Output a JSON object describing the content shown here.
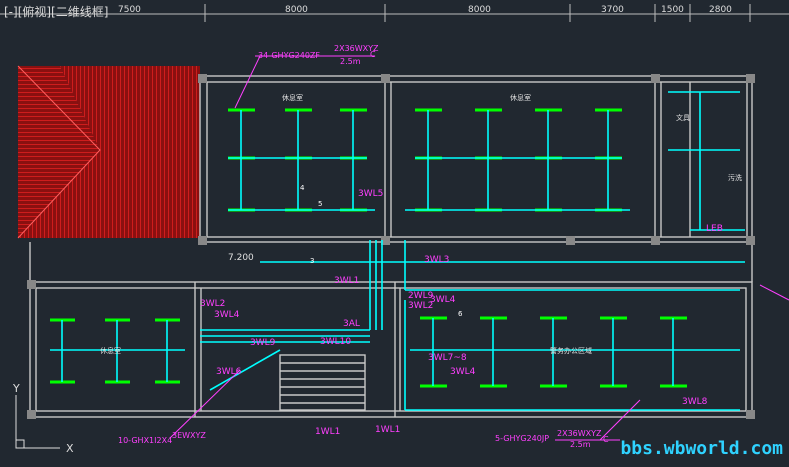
{
  "viewport": {
    "label": "[-][俯视][二维线框]"
  },
  "dimensions": [
    "7500",
    "8000",
    "8000",
    "3700",
    "1500",
    "2800"
  ],
  "elevation_mark": "7.200",
  "room_labels": [
    "休息室",
    "休息室",
    "休息室",
    "警务办公区域",
    "文具",
    "污洗"
  ],
  "annotations": {
    "cable_top": "34-GHYG240ZF",
    "cable_top_spec": "2X36WXYZ",
    "cable_top_len": "2.5m",
    "cable_top_c": "C",
    "cable_bottom_left": "10-GHX1I2X4",
    "cable_bottom_left_spec": "3EWXYZ",
    "cable_bottom_right": "5-GHYG240JP",
    "cable_bottom_right_spec": "2X36WXYZ",
    "cable_bottom_right_len": "2.5m",
    "cable_bottom_right_c": "C",
    "circuits": [
      "3WL5",
      "3WL3",
      "3WL1",
      "2WL9",
      "3WL2",
      "3AL",
      "3WL4",
      "3WL2",
      "3WL4",
      "3WL9",
      "3WL6",
      "3WL10",
      "3WL7~8",
      "3WL4",
      "3WL8",
      "1WL1",
      "1WL1",
      "LEB"
    ]
  },
  "branch_counts": [
    "3",
    "4",
    "5",
    "6"
  ],
  "ucs_icon": {
    "x_label": "X",
    "y_label": "Y"
  },
  "watermark": "bbs.wbworld.com",
  "colors": {
    "background": "#212830",
    "walls": "#c8c8c8",
    "wiring": "#00ffff",
    "fixtures": "#00ff00",
    "annotation": "#ff40ff",
    "roof_hatch": "#c01818"
  }
}
